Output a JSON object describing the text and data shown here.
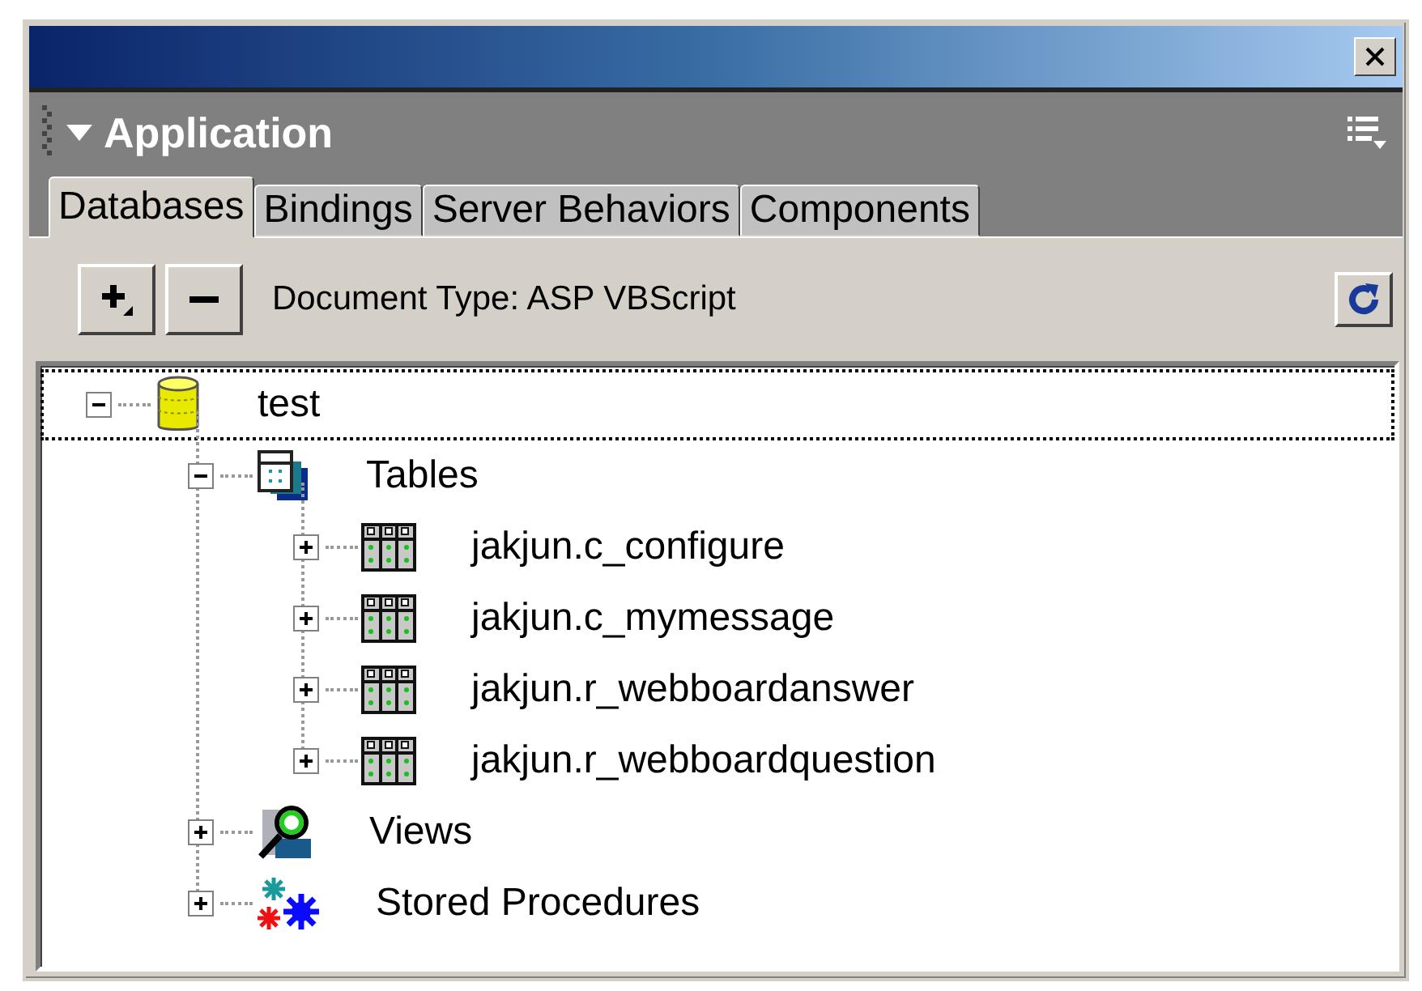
{
  "panel": {
    "title": "Application",
    "expanded": true
  },
  "tabs": [
    {
      "label": "Databases",
      "selected": true
    },
    {
      "label": "Bindings",
      "selected": false
    },
    {
      "label": "Server Behaviors",
      "selected": false
    },
    {
      "label": "Components",
      "selected": false
    }
  ],
  "toolbar": {
    "document_type": "Document Type: ASP VBScript"
  },
  "tree": [
    {
      "label": "test",
      "kind": "database",
      "expanded": true,
      "selected": true,
      "children": [
        {
          "label": "Tables",
          "kind": "tables",
          "expanded": true,
          "selected": false,
          "children": [
            {
              "label": "jakjun.c_configure",
              "kind": "table",
              "expanded": false,
              "selected": false
            },
            {
              "label": "jakjun.c_mymessage",
              "kind": "table",
              "expanded": false,
              "selected": false
            },
            {
              "label": "jakjun.r_webboardanswer",
              "kind": "table",
              "expanded": false,
              "selected": false
            },
            {
              "label": "jakjun.r_webboardquestion",
              "kind": "table",
              "expanded": false,
              "selected": false
            }
          ]
        },
        {
          "label": "Views",
          "kind": "views",
          "expanded": false,
          "selected": false
        },
        {
          "label": "Stored Procedures",
          "kind": "procedures",
          "expanded": false,
          "selected": false
        }
      ]
    }
  ]
}
